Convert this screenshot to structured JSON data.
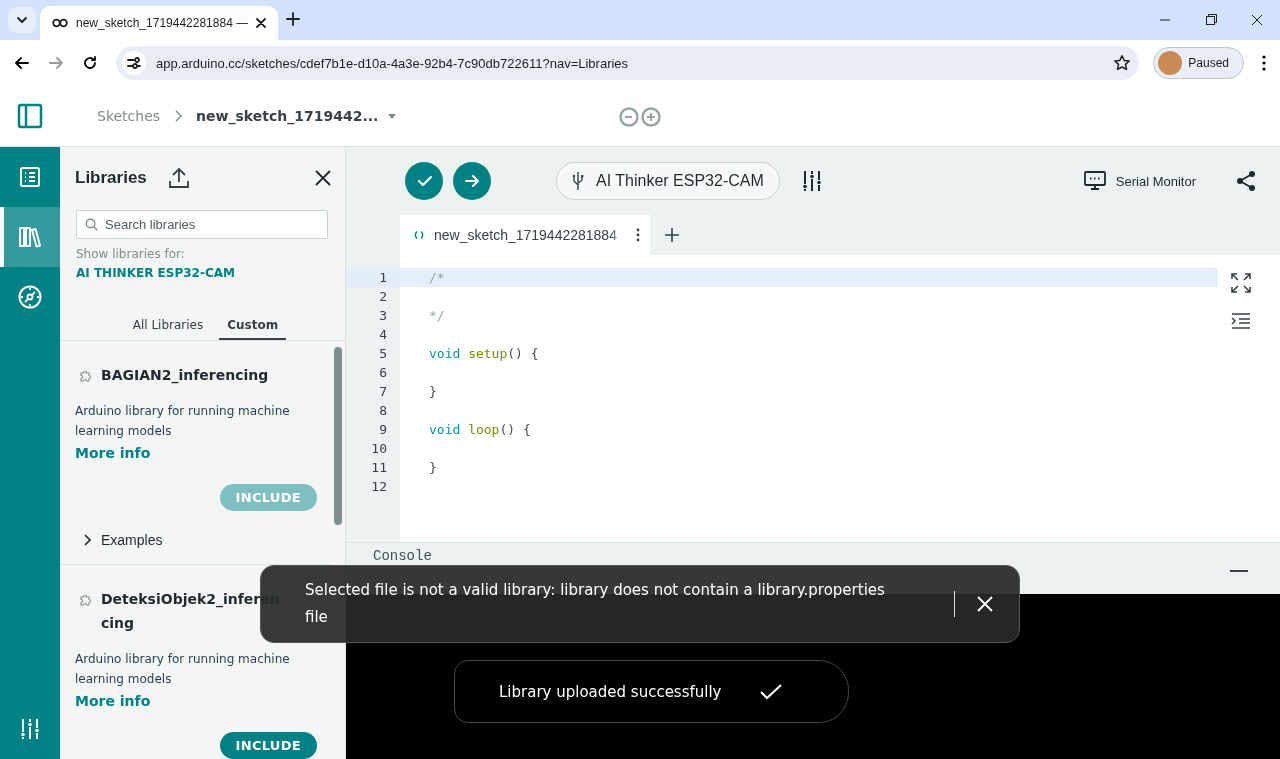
{
  "browser": {
    "tab_title": "new_sketch_1719442281884 —",
    "url": "app.arduino.cc/sketches/cdef7b1e-d10a-4a3e-92b4-7c90db722611?nav=Libraries",
    "profile": "Paused"
  },
  "header": {
    "breadcrumb": [
      "Sketches",
      "new_sketch_1719442..."
    ]
  },
  "rail": [
    {
      "kind": "sketchbook",
      "selected": false
    },
    {
      "kind": "libraries",
      "selected": true
    },
    {
      "kind": "reference",
      "selected": false
    }
  ],
  "libraries": {
    "title": "Libraries",
    "search": {
      "placeholder": "Search libraries"
    },
    "filter_label": "Show libraries for:",
    "board": "AI THINKER ESP32-CAM",
    "tabs": [
      {
        "label": "All Libraries",
        "selected": false
      },
      {
        "label": "Custom",
        "selected": true
      }
    ],
    "items": [
      {
        "name": "BAGIAN2_inferencing",
        "description": "Arduino library for running machine learning models",
        "link": "More info",
        "action": "INCLUDE",
        "disabled": true,
        "examples": {
          "label": "Examples",
          "expanded": false
        }
      },
      {
        "name": "DeteksiObjek2_inferencing",
        "description": "Arduino library for running machine learning models",
        "link": "More info",
        "action": "INCLUDE",
        "disabled": false
      }
    ]
  },
  "toolbar": {
    "board": "AI Thinker ESP32-CAM",
    "serial_monitor": "Serial Monitor"
  },
  "file_tab": {
    "label": "new_sketch_1719442281884"
  },
  "code": [
    {
      "number": "1",
      "active": true,
      "tokens": [
        {
          "kind": "comment",
          "text": "/*"
        }
      ]
    },
    {
      "number": "2",
      "active": false
    },
    {
      "number": "3",
      "active": false,
      "tokens": [
        {
          "kind": "comment",
          "text": "*/"
        }
      ]
    },
    {
      "number": "4",
      "active": false
    },
    {
      "number": "5",
      "active": false,
      "tokens": [
        {
          "kind": "keyword",
          "text": "void"
        },
        {
          "kind": "function",
          "text": "setup"
        },
        {
          "kind": "plain",
          "text": "() {"
        }
      ]
    },
    {
      "number": "6",
      "active": false
    },
    {
      "number": "7",
      "active": false,
      "tokens": [
        {
          "kind": "plain",
          "text": "}"
        }
      ]
    },
    {
      "number": "8",
      "active": false
    },
    {
      "number": "9",
      "active": false,
      "tokens": [
        {
          "kind": "keyword",
          "text": "void"
        },
        {
          "kind": "function",
          "text": "loop"
        },
        {
          "kind": "plain",
          "text": "() {"
        }
      ]
    },
    {
      "number": "10",
      "active": false
    },
    {
      "number": "11",
      "active": false,
      "tokens": [
        {
          "kind": "plain",
          "text": "}"
        }
      ]
    },
    {
      "number": "12",
      "active": false
    }
  ],
  "console": {
    "title": "Console"
  },
  "toasts": [
    {
      "kind": "error",
      "message": "Selected file is not a valid library: library does not contain a library.properties file"
    },
    {
      "kind": "success",
      "message": "Library uploaded successfully"
    }
  ]
}
